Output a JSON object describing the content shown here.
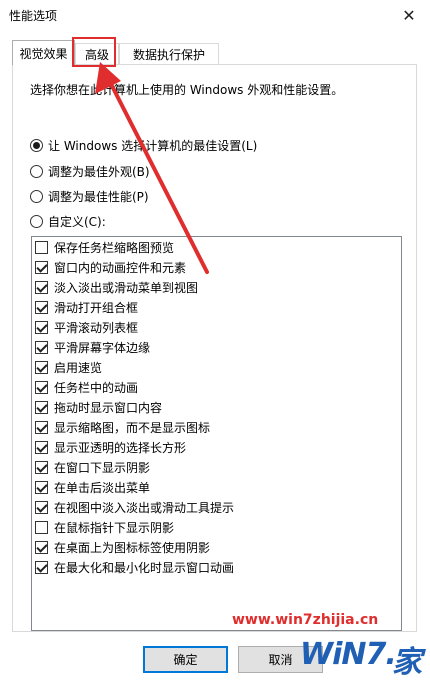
{
  "window": {
    "title": "性能选项",
    "close_glyph": "✕"
  },
  "tabs": [
    {
      "label": "视觉效果",
      "active": true
    },
    {
      "label": "高级",
      "active": false
    },
    {
      "label": "数据执行保护",
      "active": false
    }
  ],
  "intro": "选择你想在此计算机上使用的 Windows 外观和性能设置。",
  "options": [
    {
      "label": "让 Windows 选择计算机的最佳设置(L)",
      "checked": true
    },
    {
      "label": "调整为最佳外观(B)",
      "checked": false
    },
    {
      "label": "调整为最佳性能(P)",
      "checked": false
    },
    {
      "label": "自定义(C):",
      "checked": false
    }
  ],
  "effects": [
    {
      "label": "保存任务栏缩略图预览",
      "checked": false
    },
    {
      "label": "窗口内的动画控件和元素",
      "checked": true
    },
    {
      "label": "淡入淡出或滑动菜单到视图",
      "checked": true
    },
    {
      "label": "滑动打开组合框",
      "checked": true
    },
    {
      "label": "平滑滚动列表框",
      "checked": true
    },
    {
      "label": "平滑屏幕字体边缘",
      "checked": true
    },
    {
      "label": "启用速览",
      "checked": true
    },
    {
      "label": "任务栏中的动画",
      "checked": true
    },
    {
      "label": "拖动时显示窗口内容",
      "checked": true
    },
    {
      "label": "显示缩略图，而不是显示图标",
      "checked": true
    },
    {
      "label": "显示亚透明的选择长方形",
      "checked": true
    },
    {
      "label": "在窗口下显示阴影",
      "checked": true
    },
    {
      "label": "在单击后淡出菜单",
      "checked": true
    },
    {
      "label": "在视图中淡入淡出或滑动工具提示",
      "checked": true
    },
    {
      "label": "在鼠标指针下显示阴影",
      "checked": false
    },
    {
      "label": "在桌面上为图标标签使用阴影",
      "checked": true
    },
    {
      "label": "在最大化和最小化时显示窗口动画",
      "checked": true
    }
  ],
  "buttons": {
    "ok": "确定",
    "cancel": "取消"
  },
  "watermark": {
    "url": "www.win7zhijia.cn",
    "logo": "WiN7.",
    "logo_suffix": "家"
  },
  "annotation": {
    "highlight_color": "#e02d2d"
  }
}
